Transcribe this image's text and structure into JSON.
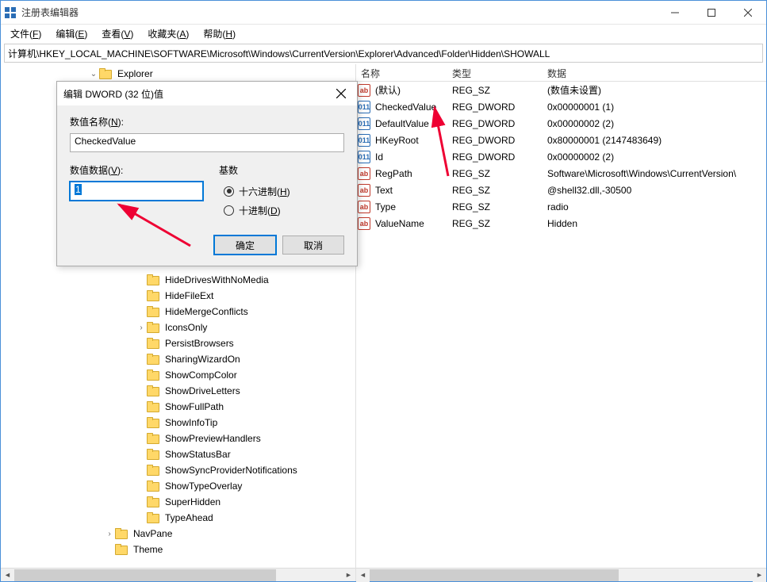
{
  "window": {
    "title": "注册表编辑器"
  },
  "menu": {
    "file": "文件(F)",
    "edit": "编辑(E)",
    "view": "查看(V)",
    "favorites": "收藏夹(A)",
    "help": "帮助(H)"
  },
  "address": "计算机\\HKEY_LOCAL_MACHINE\\SOFTWARE\\Microsoft\\Windows\\CurrentVersion\\Explorer\\Advanced\\Folder\\Hidden\\SHOWALL",
  "tree": {
    "explorer": "Explorer",
    "items": [
      "HideDrivesWithNoMedia",
      "HideFileExt",
      "HideMergeConflicts",
      "IconsOnly",
      "PersistBrowsers",
      "SharingWizardOn",
      "ShowCompColor",
      "ShowDriveLetters",
      "ShowFullPath",
      "ShowInfoTip",
      "ShowPreviewHandlers",
      "ShowStatusBar",
      "ShowSyncProviderNotifications",
      "ShowTypeOverlay",
      "SuperHidden",
      "TypeAhead"
    ],
    "navpane": "NavPane",
    "theme": "Theme"
  },
  "list": {
    "headers": {
      "name": "名称",
      "type": "类型",
      "data": "数据"
    },
    "rows": [
      {
        "icon": "sz",
        "name": "(默认)",
        "type": "REG_SZ",
        "data": "(数值未设置)"
      },
      {
        "icon": "dw",
        "name": "CheckedValue",
        "type": "REG_DWORD",
        "data": "0x00000001 (1)"
      },
      {
        "icon": "dw",
        "name": "DefaultValue",
        "type": "REG_DWORD",
        "data": "0x00000002 (2)"
      },
      {
        "icon": "dw",
        "name": "HKeyRoot",
        "type": "REG_DWORD",
        "data": "0x80000001 (2147483649)"
      },
      {
        "icon": "dw",
        "name": "Id",
        "type": "REG_DWORD",
        "data": "0x00000002 (2)"
      },
      {
        "icon": "sz",
        "name": "RegPath",
        "type": "REG_SZ",
        "data": "Software\\Microsoft\\Windows\\CurrentVersion\\"
      },
      {
        "icon": "sz",
        "name": "Text",
        "type": "REG_SZ",
        "data": "@shell32.dll,-30500"
      },
      {
        "icon": "sz",
        "name": "Type",
        "type": "REG_SZ",
        "data": "radio"
      },
      {
        "icon": "sz",
        "name": "ValueName",
        "type": "REG_SZ",
        "data": "Hidden"
      }
    ]
  },
  "dialog": {
    "title": "编辑 DWORD (32 位)值",
    "name_label": "数值名称(N):",
    "name_value": "CheckedValue",
    "data_label": "数值数据(V):",
    "data_value": "1",
    "base_label": "基数",
    "hex": "十六进制(H)",
    "dec": "十进制(D)",
    "ok": "确定",
    "cancel": "取消"
  },
  "icons": {
    "sz": "ab",
    "dw": "011"
  }
}
